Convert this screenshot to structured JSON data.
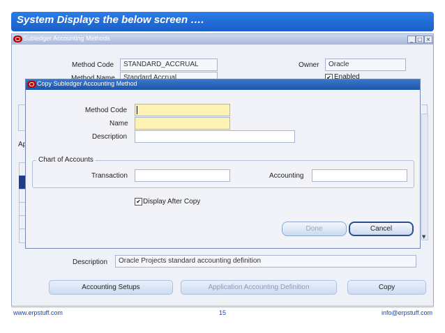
{
  "slide": {
    "title": "System Displays the below screen ….",
    "footer_left": "www.erpstuff.com",
    "page_number": "15",
    "footer_right": "info@erpstuff.com"
  },
  "colors": {
    "slide_bar": "#1a5fc9",
    "required_field": "#fdf2b4",
    "dialog_titlebar": "#1d55a8",
    "oracle_icon": "#c00000"
  },
  "background_window": {
    "title": "Subledger Accounting Methods",
    "icon": "oracle-icon",
    "method_code_label": "Method Code",
    "method_code_value": "STANDARD_ACCRUAL",
    "method_name_label": "Method Name",
    "method_name_value": "Standard Accrual",
    "owner_label": "Owner",
    "owner_value": "Oracle",
    "enabled_label": "Enabled",
    "enabled_checked": true,
    "partial_label": "Ap",
    "description_label": "Description",
    "description_value": "Oracle Projects standard accounting definition",
    "buttons": {
      "accounting_setups": "Accounting Setups",
      "application_accounting_definition": "Application Accounting Definition",
      "copy": "Copy"
    }
  },
  "dialog": {
    "title": "Copy Subledger Accounting Method",
    "icon": "oracle-icon",
    "method_code_label": "Method Code",
    "method_code_value": "",
    "name_label": "Name",
    "name_value": "",
    "description_label": "Description",
    "description_value": "",
    "chart_of_accounts_label": "Chart of Accounts",
    "transaction_label": "Transaction",
    "transaction_value": "",
    "accounting_label": "Accounting",
    "accounting_value": "",
    "display_after_copy_label": "Display After Copy",
    "display_after_copy_checked": true,
    "done_label": "Done",
    "cancel_label": "Cancel"
  }
}
